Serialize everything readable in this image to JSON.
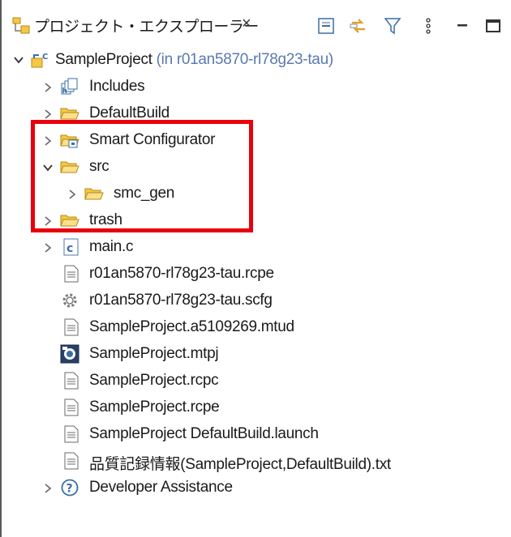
{
  "view": {
    "title": "プロジェクト・エクスプローラー",
    "close_glyph": "×",
    "toolbar": {
      "collapse_all": "collapse-all-icon",
      "link_editor": "link-editor-icon",
      "filter": "filter-icon",
      "view_menu": "view-menu-icon",
      "minimize": "minimize-icon",
      "maximize": "maximize-icon"
    }
  },
  "tree": {
    "project": {
      "name": "SampleProject",
      "suffix": " (in r01an5870-rl78g23-tau)"
    },
    "items": [
      {
        "label": "Includes"
      },
      {
        "label": "DefaultBuild"
      },
      {
        "label": "Smart Configurator"
      },
      {
        "label": "src"
      },
      {
        "label": "smc_gen"
      },
      {
        "label": "trash"
      },
      {
        "label": "main.c"
      },
      {
        "label": "r01an5870-rl78g23-tau.rcpe"
      },
      {
        "label": "r01an5870-rl78g23-tau.scfg"
      },
      {
        "label": "SampleProject.a5109269.mtud"
      },
      {
        "label": "SampleProject.mtpj"
      },
      {
        "label": "SampleProject.rcpc"
      },
      {
        "label": "SampleProject.rcpe"
      },
      {
        "label": "SampleProject DefaultBuild.launch"
      },
      {
        "label": "品質記録情報(SampleProject,DefaultBuild).txt"
      },
      {
        "label": "Developer Assistance"
      }
    ]
  },
  "colors": {
    "highlight": "#e8000b",
    "folder": "#f5c842",
    "suffix": "#5a7ab0"
  }
}
